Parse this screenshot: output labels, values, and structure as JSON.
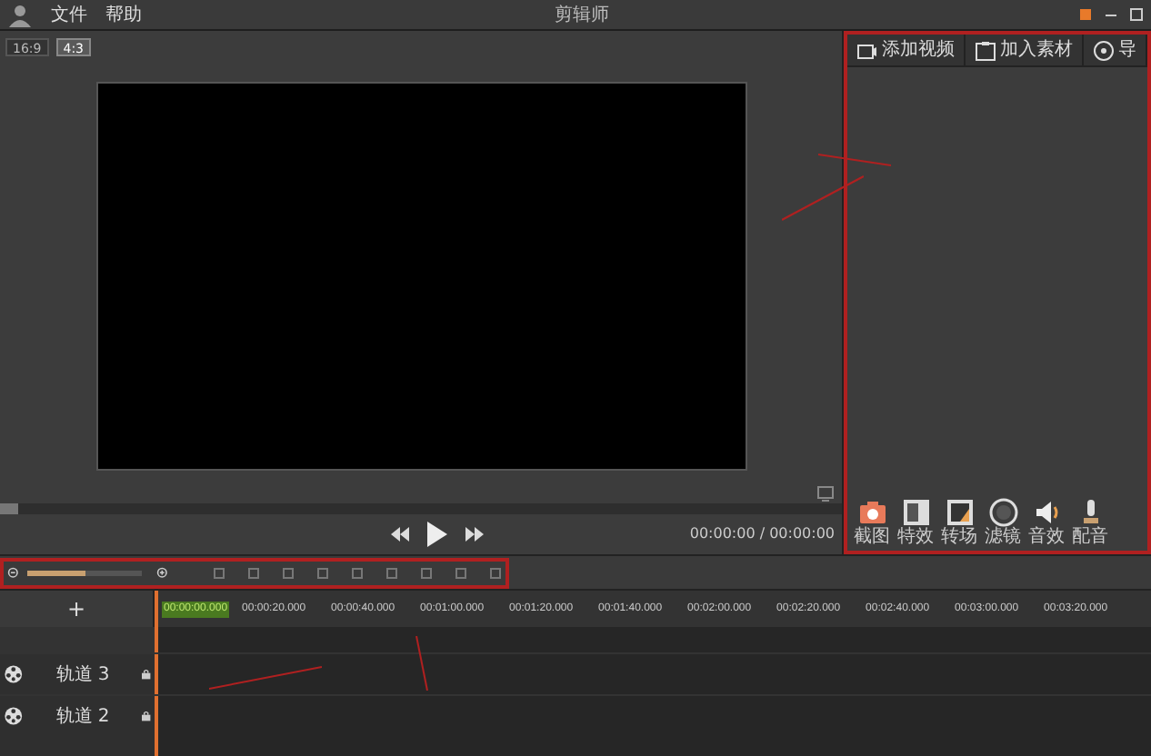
{
  "menu": {
    "items": [
      "文件",
      "帮助"
    ]
  },
  "window": {
    "title": "剪辑师"
  },
  "aspect_buttons": [
    {
      "label": "16:9",
      "selected": false
    },
    {
      "label": "4:3",
      "selected": true
    }
  ],
  "player": {
    "time": "00:00:00 / 00:00:00",
    "progress": {
      "level": 0
    }
  },
  "side_tabs": [
    {
      "label": "添加视频"
    },
    {
      "label": "加入素材"
    },
    {
      "label": "导"
    }
  ],
  "tools": [
    {
      "label": "截图"
    },
    {
      "label": "特效"
    },
    {
      "label": "转场"
    },
    {
      "label": "滤镜"
    },
    {
      "label": "音效"
    },
    {
      "label": "配音"
    }
  ],
  "zoom": {
    "level": 0.5
  },
  "timeline": {
    "add": "+",
    "current": "00:00:00.000",
    "ticks": [
      "00:00:20.000",
      "00:00:40.000",
      "00:01:00.000",
      "00:01:20.000",
      "00:01:40.000",
      "00:02:00.000",
      "00:02:20.000",
      "00:02:40.000",
      "00:03:00.000",
      "00:03:20.000"
    ]
  },
  "tracks": [
    {
      "label": "轨道 3"
    },
    {
      "label": "轨道 2"
    }
  ]
}
